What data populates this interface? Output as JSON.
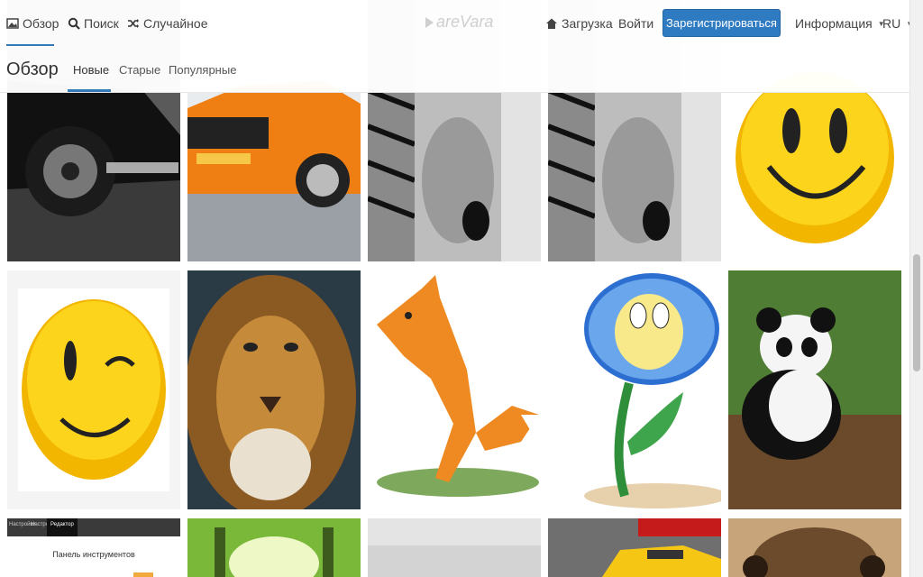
{
  "nav": {
    "overview": "Обзор",
    "search": "Поиск",
    "random": "Случайное",
    "logo": "areVara",
    "upload": "Загрузка",
    "login": "Войти",
    "register": "Зарегистрироваться",
    "info": "Информация",
    "lang": "RU"
  },
  "subnav": {
    "title": "Обзор",
    "tabs": [
      "Новые",
      "Старые",
      "Популярные"
    ]
  },
  "tiles": {
    "toolbar_panel_title": "Панель инструментов",
    "toolbar_tabs": [
      "Настройки",
      "Настройки",
      "Редактор"
    ]
  },
  "colors": {
    "accent": "#337ab7",
    "register_bg": "#2f7bc2"
  }
}
